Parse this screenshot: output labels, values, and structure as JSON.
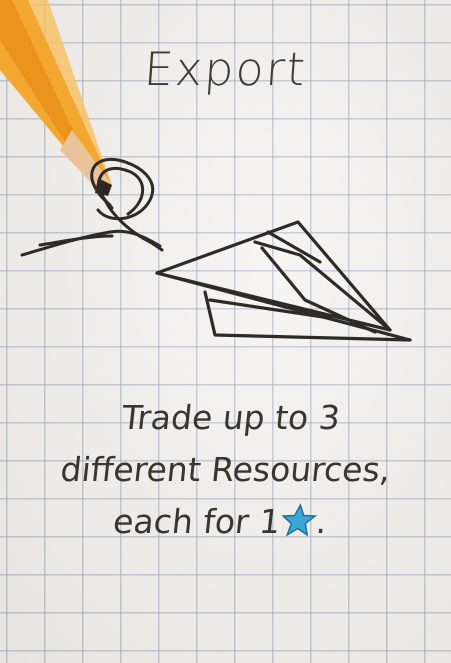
{
  "card": {
    "title": "Export",
    "description_lines": [
      "Trade up to 3",
      "different Resources,",
      "each for 1"
    ],
    "description_end": ".",
    "icons": [
      "pencil-icon",
      "paper-airplane-icon",
      "star-icon"
    ],
    "colors": {
      "paper": "#f6f4f2",
      "grid": "#96a5b9",
      "ink": "#3a3530",
      "star": "#3aa7d8",
      "pencil": "#f3a630"
    }
  }
}
